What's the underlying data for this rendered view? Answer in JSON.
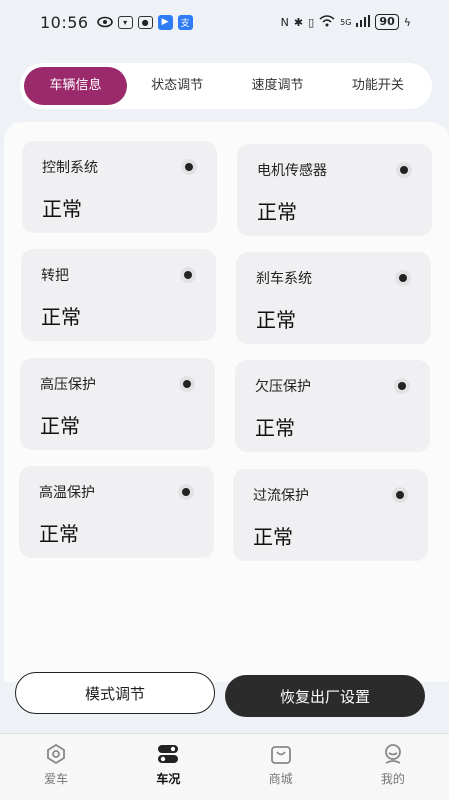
{
  "status_bar": {
    "time": "10:56",
    "battery": "90",
    "network": "5G"
  },
  "tabs": [
    {
      "label": "车辆信息",
      "active": true
    },
    {
      "label": "状态调节",
      "active": false
    },
    {
      "label": "速度调节",
      "active": false
    },
    {
      "label": "功能开关",
      "active": false
    }
  ],
  "cards": [
    {
      "title": "控制系统",
      "value": "正常"
    },
    {
      "title": "电机传感器",
      "value": "正常"
    },
    {
      "title": "转把",
      "value": "正常"
    },
    {
      "title": "刹车系统",
      "value": "正常"
    },
    {
      "title": "高压保护",
      "value": "正常"
    },
    {
      "title": "欠压保护",
      "value": "正常"
    },
    {
      "title": "高温保护",
      "value": "正常"
    },
    {
      "title": "过流保护",
      "value": "正常"
    }
  ],
  "actions": {
    "mode_label": "模式调节",
    "reset_label": "恢复出厂设置"
  },
  "bottom_nav": [
    {
      "label": "爱车",
      "icon": "eye-icon",
      "active": false
    },
    {
      "label": "车况",
      "icon": "toggle-icon",
      "active": true
    },
    {
      "label": "商城",
      "icon": "shopping-bag-icon",
      "active": false
    },
    {
      "label": "我的",
      "icon": "profile-icon",
      "active": false
    }
  ]
}
